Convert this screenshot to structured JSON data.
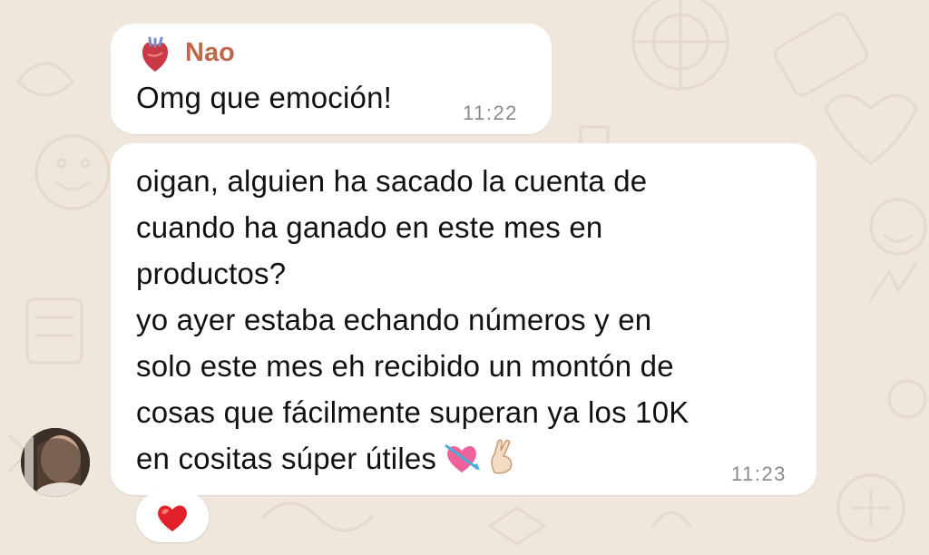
{
  "messages": [
    {
      "sender": "Nao",
      "text": "Omg que emoción!",
      "time": "11:22"
    },
    {
      "text": "oigan, alguien ha sacado la cuenta de\ncuando ha ganado en este mes en\nproductos?\nyo ayer estaba echando números y en\nsolo este mes eh recibido un montón de\ncosas que fácilmente superan ya los 10K\nen cositas súper útiles",
      "emojis": [
        "heart-with-arrow-icon",
        "crossed-fingers-icon"
      ],
      "time": "11:23",
      "reaction": "red-heart-icon"
    }
  ],
  "colors": {
    "background": "#efe7dc",
    "bubble": "#ffffff",
    "sender_name": "#c0684a",
    "timestamp": "#8a8a8a"
  }
}
